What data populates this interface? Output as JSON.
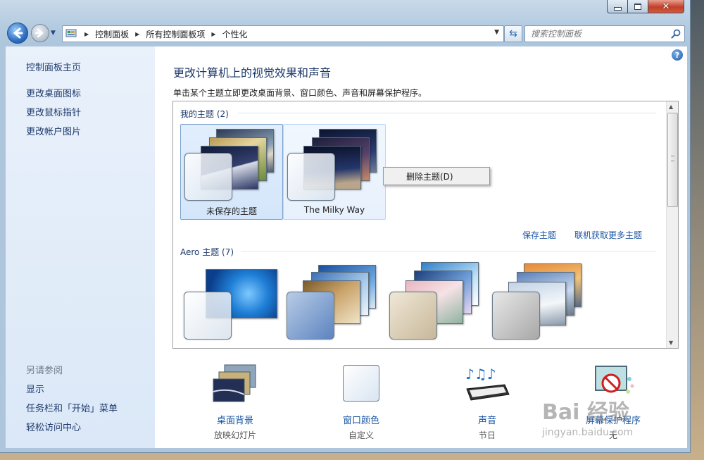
{
  "breadcrumb": [
    "控制面板",
    "所有控制面板项",
    "个性化"
  ],
  "search": {
    "placeholder": "搜索控制面板"
  },
  "left_nav": {
    "home": "控制面板主页",
    "links": [
      "更改桌面图标",
      "更改鼠标指针",
      "更改帐户图片"
    ],
    "see_also_title": "另请参阅",
    "see_also": [
      "显示",
      "任务栏和「开始」菜单",
      "轻松访问中心"
    ]
  },
  "main": {
    "title": "更改计算机上的视觉效果和声音",
    "subtitle": "单击某个主题立即更改桌面背景、窗口颜色、声音和屏幕保护程序。",
    "my_themes": {
      "label": "我的主题 (2)",
      "items": [
        "未保存的主题",
        "The Milky Way"
      ]
    },
    "context_menu": "删除主题(D)",
    "save_theme": "保存主题",
    "get_more": "联机获取更多主题",
    "aero": {
      "label": "Aero 主题 (7)"
    }
  },
  "bottom": [
    {
      "label": "桌面背景",
      "value": "放映幻灯片"
    },
    {
      "label": "窗口颜色",
      "value": "自定义"
    },
    {
      "label": "声音",
      "value": "节日"
    },
    {
      "label": "屏幕保护程序",
      "value": "无"
    }
  ],
  "watermark": {
    "brand": "Bai 经验",
    "url": "jingyan.baidu.com"
  },
  "colors": {
    "link": "#1b56a3",
    "heading": "#1e3a6c",
    "selection": "#d4e6fb"
  }
}
